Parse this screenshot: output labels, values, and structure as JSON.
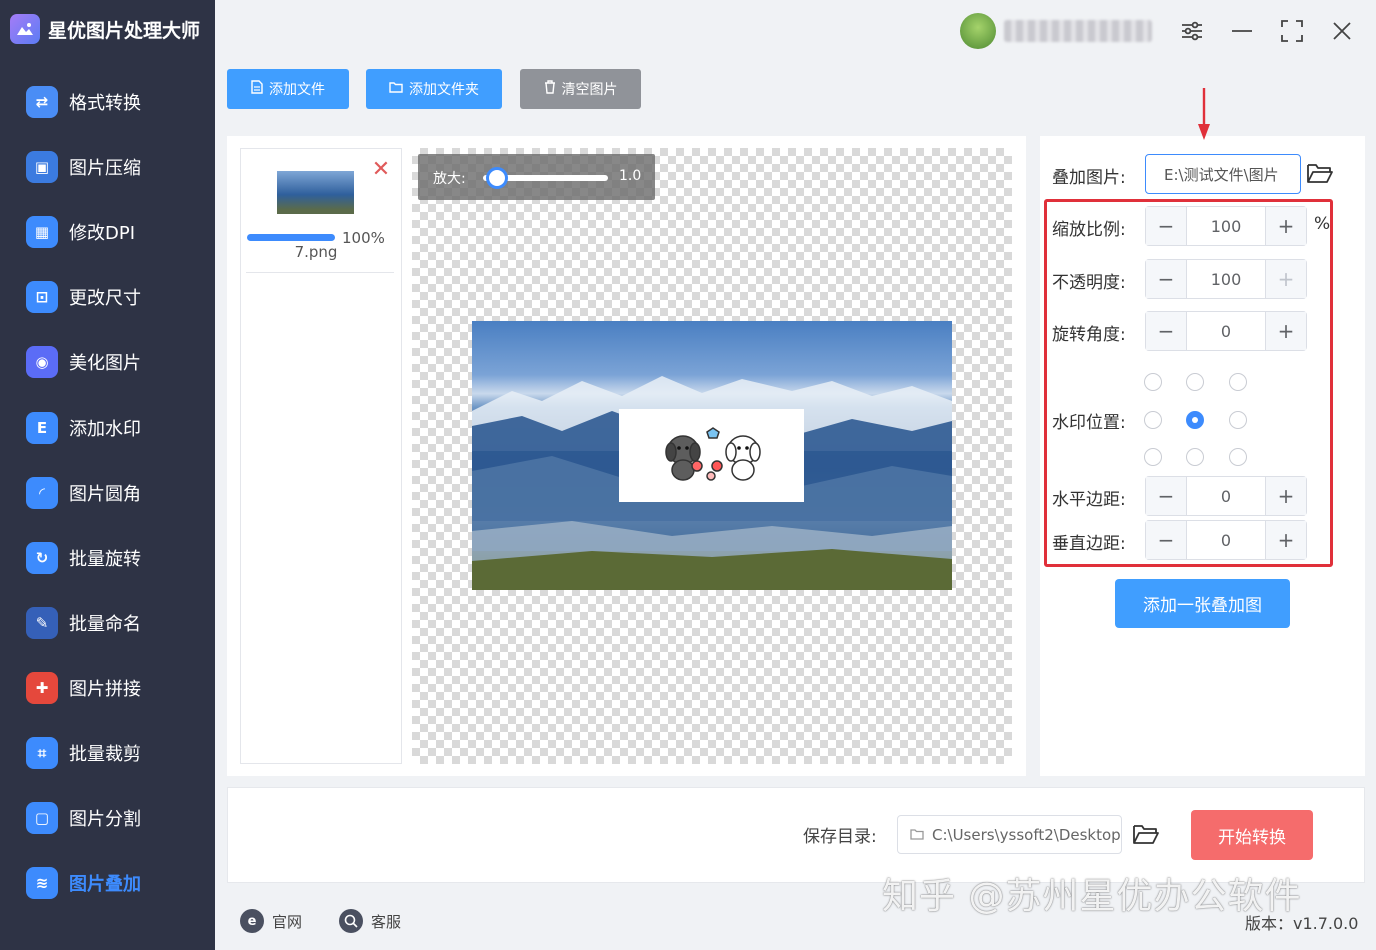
{
  "app": {
    "title": "星优图片处理大师"
  },
  "sidebar": {
    "items": [
      {
        "label": "格式转换",
        "icon": "image-convert-icon",
        "color": "#4a8df5"
      },
      {
        "label": "图片压缩",
        "icon": "compress-icon",
        "color": "#3b7be0"
      },
      {
        "label": "修改DPI",
        "icon": "dpi-icon",
        "color": "#3d8bfd"
      },
      {
        "label": "更改尺寸",
        "icon": "resize-icon",
        "color": "#3d8bfd"
      },
      {
        "label": "美化图片",
        "icon": "beautify-icon",
        "color": "#5b6cf6"
      },
      {
        "label": "添加水印",
        "icon": "watermark-icon",
        "color": "#3d8bfd"
      },
      {
        "label": "图片圆角",
        "icon": "round-corner-icon",
        "color": "#3d8bfd"
      },
      {
        "label": "批量旋转",
        "icon": "rotate-icon",
        "color": "#3d8bfd"
      },
      {
        "label": "批量命名",
        "icon": "rename-icon",
        "color": "#3560b8"
      },
      {
        "label": "图片拼接",
        "icon": "puzzle-icon",
        "color": "#e5483c"
      },
      {
        "label": "批量裁剪",
        "icon": "crop-icon",
        "color": "#3d8bfd"
      },
      {
        "label": "图片分割",
        "icon": "split-icon",
        "color": "#3d8bfd"
      },
      {
        "label": "图片叠加",
        "icon": "layers-icon",
        "color": "#3d8bfd"
      }
    ],
    "active_index": 12
  },
  "toolbar": {
    "add_file": "添加文件",
    "add_folder": "添加文件夹",
    "clear_images": "清空图片"
  },
  "file_list": {
    "items": [
      {
        "name": "7.png",
        "progress_text": "100%",
        "progress": 1.0
      }
    ]
  },
  "preview": {
    "zoom_label": "放大:",
    "zoom_value": "1.0"
  },
  "settings": {
    "overlay_image_label": "叠加图片:",
    "overlay_image_path": "E:\\测试文件\\图片",
    "scale_label": "缩放比例:",
    "scale_value": "100",
    "scale_unit": "%",
    "opacity_label": "不透明度:",
    "opacity_value": "100",
    "rotation_label": "旋转角度:",
    "rotation_value": "0",
    "position_label": "水印位置:",
    "position_selected": "center",
    "h_margin_label": "水平边距:",
    "h_margin_value": "0",
    "v_margin_label": "垂直边距:",
    "v_margin_value": "0",
    "add_overlay_button": "添加一张叠加图"
  },
  "output": {
    "save_dir_label": "保存目录:",
    "save_dir_path": "C:\\Users\\yssoft2\\Desktop",
    "start_button": "开始转换"
  },
  "footer": {
    "website": "官网",
    "support": "客服",
    "version": "版本：v1.7.0.0"
  },
  "watermark": "知乎 @苏州星优办公软件",
  "colors": {
    "sidebar_bg": "#2e3345",
    "primary": "#409eff",
    "danger": "#f56c6c",
    "highlight_border": "#e0303a",
    "clear_button": "#909399"
  }
}
